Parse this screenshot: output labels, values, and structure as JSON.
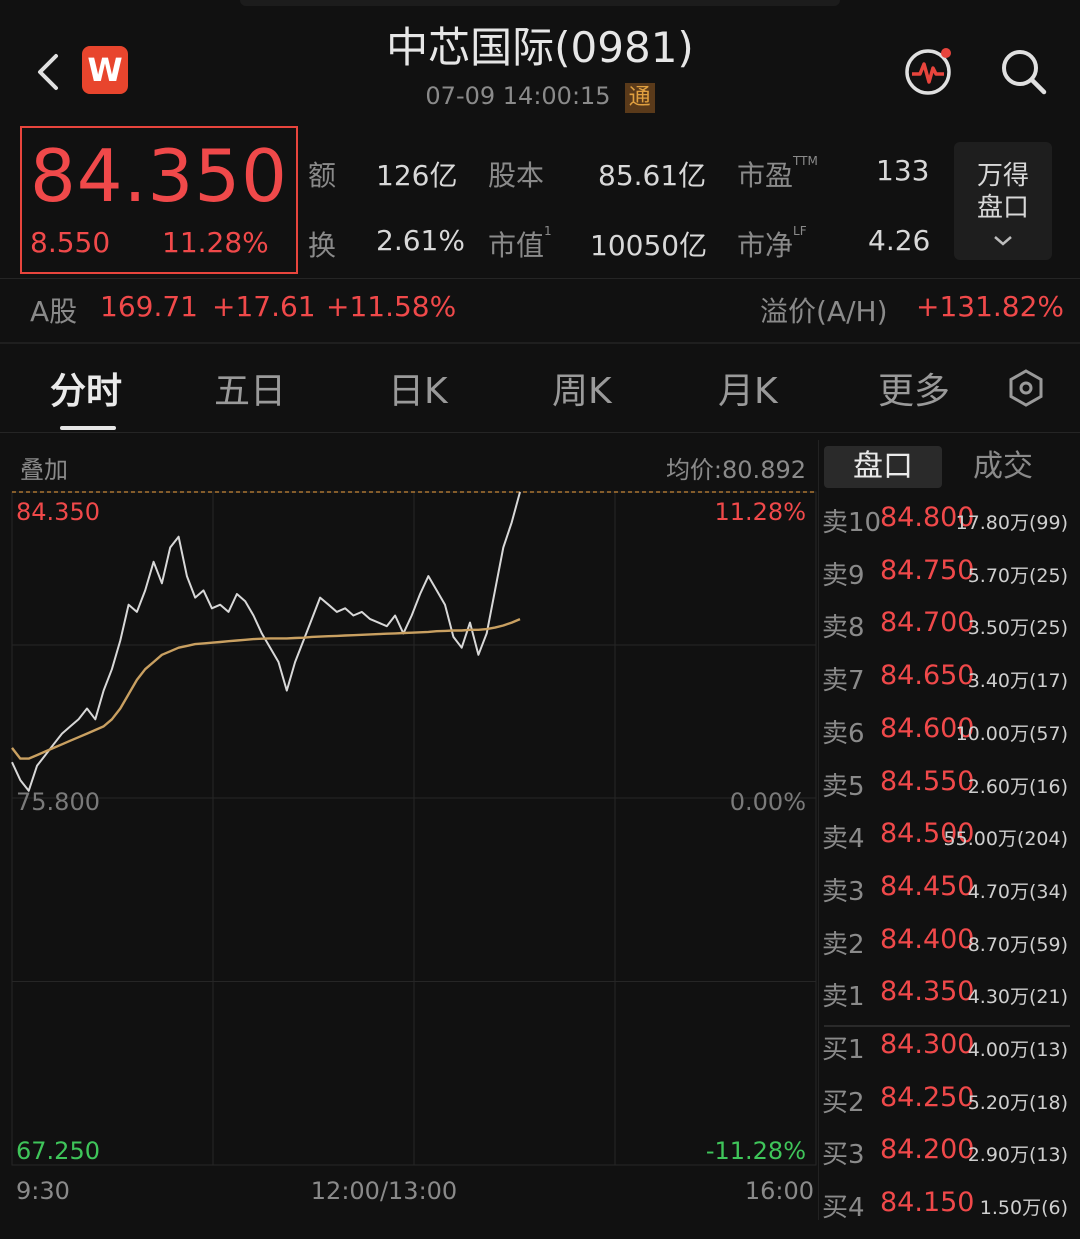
{
  "header": {
    "title": "中芯国际(0981)",
    "datetime": "07-09 14:00:15",
    "connect_badge": "通",
    "logo_text": "W"
  },
  "quote": {
    "price": "84.350",
    "change": "8.550",
    "change_pct": "11.28%"
  },
  "stats": [
    {
      "label": "额",
      "value": "126亿"
    },
    {
      "label": "股本",
      "value": "85.61亿"
    },
    {
      "label": "市盈",
      "sup": "TTM",
      "value": "133"
    },
    {
      "label": "换",
      "value": "2.61%"
    },
    {
      "label": "市值",
      "sup": "1",
      "value": "10050亿"
    },
    {
      "label": "市净",
      "sup": "LF",
      "value": "4.26"
    }
  ],
  "wande_button": {
    "line1": "万得",
    "line2": "盘口"
  },
  "a_share": {
    "label": "A股",
    "price": "169.71",
    "change": "+17.61",
    "change_pct": "+11.58%",
    "premium_label": "溢价(A/H)",
    "premium": "+131.82%"
  },
  "tabs": [
    "分时",
    "五日",
    "日K",
    "周K",
    "月K",
    "更多"
  ],
  "chart_header": {
    "overlay": "叠加",
    "avg_price": "均价:80.892"
  },
  "chart_data": {
    "type": "line",
    "x_labels": [
      "9:30",
      "12:00/13:00",
      "16:00"
    ],
    "y_left_labels": [
      "84.350",
      "75.800",
      "67.250"
    ],
    "y_right_labels": [
      "11.28%",
      "0.00%",
      "-11.28%"
    ],
    "ylim": [
      67.25,
      84.35
    ],
    "series": [
      {
        "name": "price",
        "color": "#d8d8d8",
        "values": [
          76.8,
          76.3,
          76.0,
          76.7,
          77.0,
          77.3,
          77.6,
          77.8,
          78.0,
          78.3,
          78.0,
          78.8,
          79.4,
          80.2,
          81.2,
          81.0,
          81.6,
          82.4,
          81.8,
          82.8,
          83.1,
          82.0,
          81.4,
          81.6,
          81.1,
          81.2,
          81.0,
          81.5,
          81.3,
          80.9,
          80.4,
          80.0,
          79.6,
          78.8,
          79.6,
          80.2,
          80.8,
          81.4,
          81.2,
          81.0,
          81.1,
          80.9,
          81.0,
          80.8,
          80.7,
          80.6,
          80.9,
          80.4,
          80.9,
          81.5,
          82.0,
          81.6,
          81.2,
          80.3,
          80.0,
          80.7,
          79.8,
          80.4,
          81.6,
          82.8,
          83.5,
          84.35
        ]
      },
      {
        "name": "avg",
        "color": "#c9a061",
        "values": [
          77.2,
          76.9,
          76.9,
          77.0,
          77.1,
          77.2,
          77.3,
          77.4,
          77.5,
          77.6,
          77.7,
          77.8,
          78.0,
          78.3,
          78.7,
          79.1,
          79.4,
          79.6,
          79.8,
          79.9,
          80.0,
          80.05,
          80.1,
          80.12,
          80.14,
          80.16,
          80.18,
          80.2,
          80.22,
          80.24,
          80.25,
          80.26,
          80.26,
          80.26,
          80.27,
          80.28,
          80.3,
          80.31,
          80.32,
          80.33,
          80.34,
          80.35,
          80.36,
          80.37,
          80.38,
          80.39,
          80.4,
          80.41,
          80.42,
          80.43,
          80.44,
          80.46,
          80.47,
          80.48,
          80.48,
          80.5,
          80.5,
          80.52,
          80.56,
          80.62,
          80.7,
          80.8
        ]
      }
    ],
    "grid": true
  },
  "orderbook": {
    "tabs": [
      "盘口",
      "成交"
    ],
    "rows": [
      {
        "side": "卖10",
        "price": "84.800",
        "volume": "17.80万(99)"
      },
      {
        "side": "卖9",
        "price": "84.750",
        "volume": "5.70万(25)"
      },
      {
        "side": "卖8",
        "price": "84.700",
        "volume": "3.50万(25)"
      },
      {
        "side": "卖7",
        "price": "84.650",
        "volume": "3.40万(17)"
      },
      {
        "side": "卖6",
        "price": "84.600",
        "volume": "10.00万(57)"
      },
      {
        "side": "卖5",
        "price": "84.550",
        "volume": "2.60万(16)"
      },
      {
        "side": "卖4",
        "price": "84.500",
        "volume": "55.00万(204)"
      },
      {
        "side": "卖3",
        "price": "84.450",
        "volume": "4.70万(34)"
      },
      {
        "side": "卖2",
        "price": "84.400",
        "volume": "8.70万(59)"
      },
      {
        "side": "卖1",
        "price": "84.350",
        "volume": "4.30万(21)"
      },
      {
        "side": "买1",
        "price": "84.300",
        "volume": "4.00万(13)"
      },
      {
        "side": "买2",
        "price": "84.250",
        "volume": "5.20万(18)"
      },
      {
        "side": "买3",
        "price": "84.200",
        "volume": "2.90万(13)"
      },
      {
        "side": "买4",
        "price": "84.150",
        "volume": "1.50万(6)"
      }
    ]
  },
  "colors": {
    "up": "#f0494a",
    "down": "#3fc55a",
    "avg_line": "#c9a061",
    "background": "#111111"
  },
  "icons": [
    "back-arrow-icon",
    "stock-pulse-icon",
    "search-icon",
    "settings-hexagon-icon",
    "chevron-down-icon"
  ]
}
